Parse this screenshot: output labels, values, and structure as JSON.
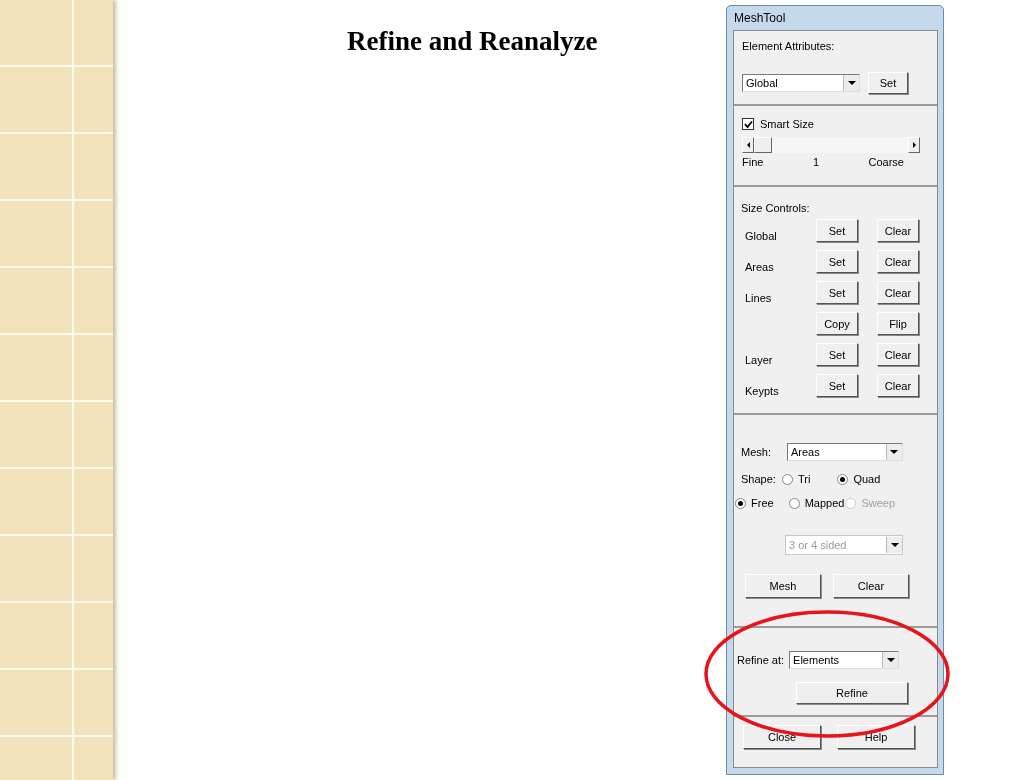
{
  "slide": {
    "title": "Refine and Reanalyze"
  },
  "window": {
    "title": "MeshTool"
  },
  "element_attributes": {
    "label": "Element Attributes:",
    "dropdown": "Global",
    "button": "Set"
  },
  "smart_size": {
    "label": "Smart Size",
    "checked": true,
    "level": 0,
    "min_label": "Fine",
    "value": "1",
    "max_label": "Coarse"
  },
  "size_controls": {
    "label": "Size Controls:",
    "rows": [
      {
        "label": "Global",
        "buttons": [
          "Set",
          "Clear"
        ]
      },
      {
        "label": "Areas",
        "buttons": [
          "Set",
          "Clear"
        ]
      },
      {
        "label": "Lines",
        "buttons": [
          "Set",
          "Clear"
        ]
      },
      {
        "buttons": [
          "Copy",
          "Flip"
        ]
      },
      {
        "label": "Layer",
        "buttons": [
          "Set",
          "Clear"
        ]
      },
      {
        "label": "Keypts",
        "buttons": [
          "Set",
          "Clear"
        ]
      }
    ]
  },
  "mesh": {
    "label": "Mesh:",
    "dropdown": "Areas",
    "shape_label": "Shape:",
    "shape_options": [
      {
        "label": "Tri",
        "selected": false,
        "disabled": false
      },
      {
        "label": "Quad",
        "selected": true,
        "disabled": false
      }
    ],
    "mode_options": [
      {
        "label": "Free",
        "selected": true,
        "disabled": false
      },
      {
        "label": "Mapped",
        "selected": false,
        "disabled": false
      },
      {
        "label": "Sweep",
        "selected": false,
        "disabled": true
      }
    ],
    "sided_dropdown": {
      "value": "3 or 4 sided",
      "disabled": true
    },
    "buttons": [
      "Mesh",
      "Clear"
    ]
  },
  "refine": {
    "label": "Refine at:",
    "dropdown": "Elements",
    "button": "Refine"
  },
  "footer_buttons": [
    "Close",
    "Help"
  ]
}
